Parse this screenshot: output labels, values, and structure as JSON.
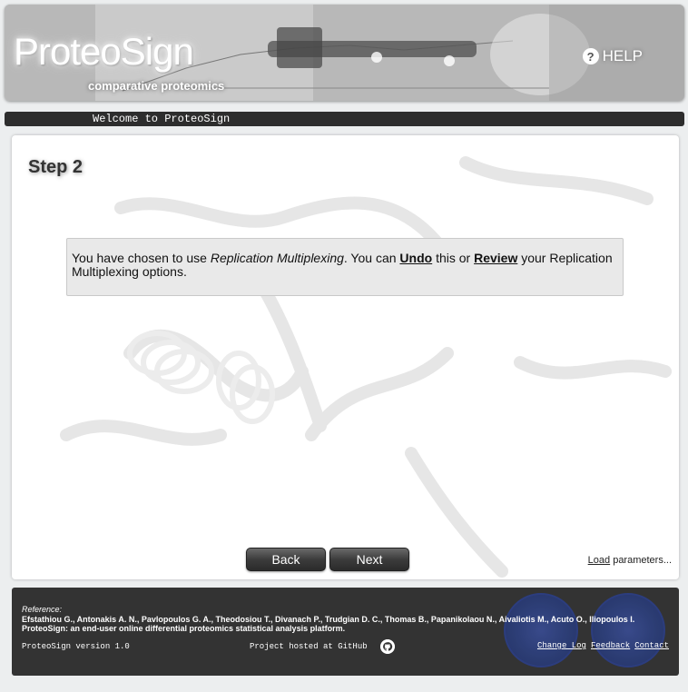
{
  "header": {
    "logo_title": "ProteoSign",
    "logo_subtitle": "comparative proteomics",
    "help_label": "HELP",
    "help_icon": "question-circle-icon"
  },
  "welcome_bar": {
    "text": "Welcome to ProteoSign"
  },
  "main": {
    "step_title": "Step 2",
    "notice": {
      "part1": "You have chosen to use ",
      "emphasis": "Replication Multiplexing",
      "part2": ". You can ",
      "undo_link": "Undo",
      "part3": " this or ",
      "review_link": "Review",
      "part4": " your Replication Multiplexing options."
    },
    "back_button": "Back",
    "next_button": "Next",
    "load_link": "Load",
    "load_suffix": " parameters..."
  },
  "footer": {
    "reference_title": "Reference:",
    "reference_authors": "Efstathiou G., Antonakis A. N., Pavlopoulos G. A., Theodosiou T., Divanach P., Trudgian D. C., Thomas B., Papanikolaou N., Aivaliotis M., Acuto O., Iliopoulos I.",
    "reference_paper": "ProteoSign: an end-user online differential proteomics statistical analysis platform.",
    "version": "ProteoSign version 1.0",
    "github_text": "Project hosted at GitHub",
    "links": [
      "Change Log",
      "Feedback",
      "Contact"
    ]
  },
  "colors": {
    "dark_bar": "#2d2d2d",
    "footer_bg": "#333333",
    "notice_bg": "#e9e9e9",
    "seal_blue": "#2b3f8c"
  }
}
